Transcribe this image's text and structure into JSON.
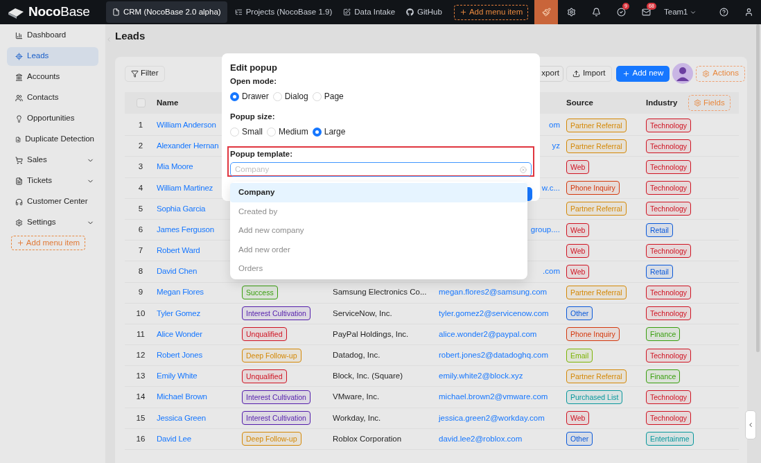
{
  "header": {
    "logo": "**Noco**Base",
    "nav": [
      {
        "label": "CRM (NocoBase 2.0 alpha)",
        "selected": true
      },
      {
        "label": "Projects (NocoBase 1.9)",
        "selected": false
      },
      {
        "label": "Data Intake",
        "selected": false
      },
      {
        "label": "GitHub",
        "selected": false
      }
    ],
    "add_menu_item": "Add menu item",
    "badges": [
      "9",
      "68"
    ],
    "team": "Team1"
  },
  "sidebar": {
    "items": [
      {
        "label": "Dashboard",
        "selected": false,
        "has_submenu": false
      },
      {
        "label": "Leads",
        "selected": true,
        "has_submenu": false
      },
      {
        "label": "Accounts",
        "selected": false,
        "has_submenu": false
      },
      {
        "label": "Contacts",
        "selected": false,
        "has_submenu": false
      },
      {
        "label": "Opportunities",
        "selected": false,
        "has_submenu": false
      },
      {
        "label": "Duplicate Detection",
        "selected": false,
        "has_submenu": false
      },
      {
        "label": "Sales",
        "selected": false,
        "has_submenu": true
      },
      {
        "label": "Tickets",
        "selected": false,
        "has_submenu": true
      },
      {
        "label": "Customer Center",
        "selected": false,
        "has_submenu": false
      },
      {
        "label": "Settings",
        "selected": false,
        "has_submenu": true
      }
    ],
    "add_menu_item": "Add menu item"
  },
  "page": {
    "title": "Leads",
    "toolbar": {
      "filter": "Filter",
      "export": "xport",
      "import": "Import",
      "add_new": "Add new",
      "actions": "Actions"
    },
    "table": {
      "select_all_checked": false,
      "columns": [
        "Name",
        "Source",
        "Industry"
      ],
      "fields": "Fields",
      "rows": [
        {
          "index": "1",
          "name": "William Anderson",
          "email_fragment": "om",
          "source": {
            "label": "Partner Referral",
            "color": "#d48806"
          },
          "industry": {
            "label": "Technology",
            "color": "#cf1322"
          }
        },
        {
          "index": "2",
          "name": "Alexander Hernan",
          "email_fragment": "yz",
          "source": {
            "label": "Partner Referral",
            "color": "#d48806"
          },
          "industry": {
            "label": "Technology",
            "color": "#cf1322"
          }
        },
        {
          "index": "3",
          "name": "Mia Moore",
          "source": {
            "label": "Web",
            "color": "#cf1322"
          },
          "industry": {
            "label": "Technology",
            "color": "#cf1322"
          }
        },
        {
          "index": "4",
          "name": "William Martinez",
          "email_fragment": "w.c...",
          "source": {
            "label": "Phone Inquiry",
            "color": "#d4380d"
          },
          "industry": {
            "label": "Technology",
            "color": "#cf1322"
          }
        },
        {
          "index": "5",
          "name": "Sophia Garcia",
          "source": {
            "label": "Partner Referral",
            "color": "#d48806"
          },
          "industry": {
            "label": "Technology",
            "color": "#cf1322"
          }
        },
        {
          "index": "6",
          "name": "James Ferguson",
          "email_fragment": "group....",
          "source": {
            "label": "Web",
            "color": "#cf1322"
          },
          "industry": {
            "label": "Retail",
            "color": "#0958d9"
          }
        },
        {
          "index": "7",
          "name": "Robert Ward",
          "source": {
            "label": "Web",
            "color": "#cf1322"
          },
          "industry": {
            "label": "Technology",
            "color": "#cf1322"
          }
        },
        {
          "index": "8",
          "name": "David Chen",
          "email_fragment": ".com",
          "source": {
            "label": "Web",
            "color": "#cf1322"
          },
          "industry": {
            "label": "Retail",
            "color": "#0958d9"
          }
        },
        {
          "index": "9",
          "name": "Megan Flores",
          "status": {
            "label": "Success",
            "color": "#389e0d"
          },
          "company": "Samsung Electronics Co...",
          "email": "megan.flores2@samsung.com",
          "source": {
            "label": "Partner Referral",
            "color": "#d48806"
          },
          "industry": {
            "label": "Technology",
            "color": "#cf1322"
          }
        },
        {
          "index": "10",
          "name": "Tyler Gomez",
          "status": {
            "label": "Interest Cultivation",
            "color": "#531dab"
          },
          "company": "ServiceNow, Inc.",
          "email": "tyler.gomez2@servicenow.com",
          "source": {
            "label": "Other",
            "color": "#0958d9"
          },
          "industry": {
            "label": "Technology",
            "color": "#cf1322"
          }
        },
        {
          "index": "11",
          "name": "Alice Wonder",
          "status": {
            "label": "Unqualified",
            "color": "#cf1322"
          },
          "company": "PayPal Holdings, Inc.",
          "email": "alice.wonder2@paypal.com",
          "source": {
            "label": "Phone Inquiry",
            "color": "#d4380d"
          },
          "industry": {
            "label": "Finance",
            "color": "#389e0d"
          }
        },
        {
          "index": "12",
          "name": "Robert Jones",
          "status": {
            "label": "Deep Follow-up",
            "color": "#d48806"
          },
          "company": "Datadog, Inc.",
          "email": "robert.jones2@datadoghq.com",
          "source": {
            "label": "Email",
            "color": "#7cb305"
          },
          "industry": {
            "label": "Technology",
            "color": "#cf1322"
          }
        },
        {
          "index": "13",
          "name": "Emily White",
          "status": {
            "label": "Unqualified",
            "color": "#cf1322"
          },
          "company": "Block, Inc. (Square)",
          "email": "emily.white2@block.xyz",
          "source": {
            "label": "Partner Referral",
            "color": "#d48806"
          },
          "industry": {
            "label": "Finance",
            "color": "#389e0d"
          }
        },
        {
          "index": "14",
          "name": "Michael Brown",
          "status": {
            "label": "Interest Cultivation",
            "color": "#531dab"
          },
          "company": "VMware, Inc.",
          "email": "michael.brown2@vmware.com",
          "source": {
            "label": "Purchased List",
            "color": "#08979c"
          },
          "industry": {
            "label": "Technology",
            "color": "#cf1322"
          }
        },
        {
          "index": "15",
          "name": "Jessica Green",
          "status": {
            "label": "Interest Cultivation",
            "color": "#531dab"
          },
          "company": "Workday, Inc.",
          "email": "jessica.green2@workday.com",
          "source": {
            "label": "Web",
            "color": "#cf1322"
          },
          "industry": {
            "label": "Technology",
            "color": "#cf1322"
          }
        },
        {
          "index": "16",
          "name": "David Lee",
          "status": {
            "label": "Deep Follow-up",
            "color": "#d48806"
          },
          "company": "Roblox Corporation",
          "email": "david.lee2@roblox.com",
          "source": {
            "label": "Other",
            "color": "#0958d9"
          },
          "industry": {
            "label": "Entertainme",
            "color": "#08979c"
          }
        }
      ]
    }
  },
  "modal": {
    "title": "Edit popup",
    "open_mode": {
      "label": "Open mode:",
      "options": [
        {
          "label": "Drawer",
          "selected": true
        },
        {
          "label": "Dialog",
          "selected": false
        },
        {
          "label": "Page",
          "selected": false
        }
      ]
    },
    "popup_size": {
      "label": "Popup size:",
      "options": [
        {
          "label": "Small",
          "selected": false
        },
        {
          "label": "Medium",
          "selected": false
        },
        {
          "label": "Large",
          "selected": true
        }
      ]
    },
    "popup_template": {
      "label": "Popup template:",
      "placeholder": "Company",
      "options": [
        {
          "label": "Company",
          "selected": true
        },
        {
          "label": "Created by",
          "selected": false
        },
        {
          "label": "Add new company",
          "selected": false
        },
        {
          "label": "Add new order",
          "selected": false
        },
        {
          "label": "Orders",
          "selected": false
        }
      ]
    }
  }
}
